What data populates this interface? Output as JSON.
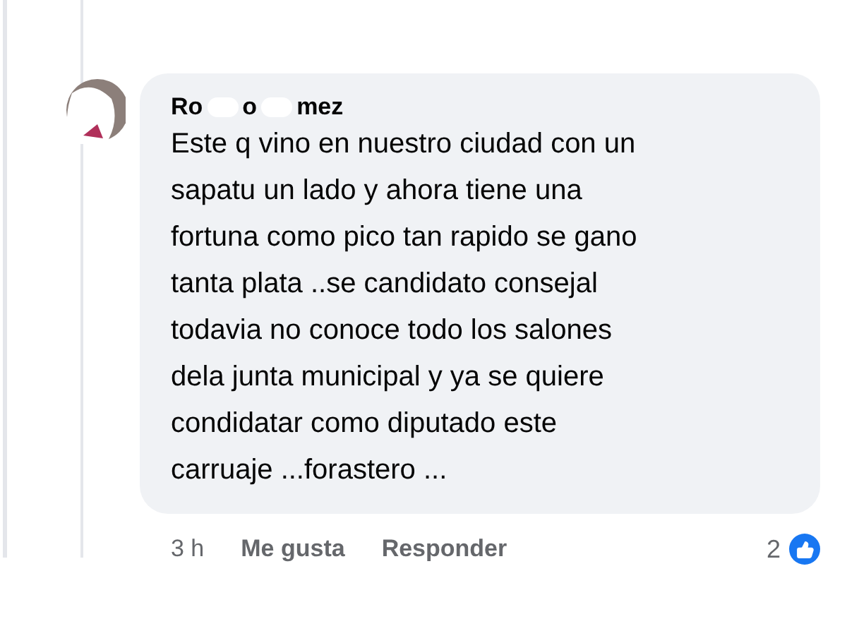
{
  "comment": {
    "author_parts": [
      "Ro",
      "o",
      "mez"
    ],
    "text": "Este q vino en nuestro ciudad con un\nsapatu un lado y ahora tiene una\nfortuna como pico tan rapido se gano\ntanta plata ..se candidato consejal\ntodavia no conoce todo los salones\ndela junta municipal y ya se quiere\ncondidatar como diputado este\ncarruaje ...forastero ...",
    "time": "3 h",
    "actions": [
      "Me gusta",
      "Responder"
    ],
    "reaction_count": "2"
  }
}
